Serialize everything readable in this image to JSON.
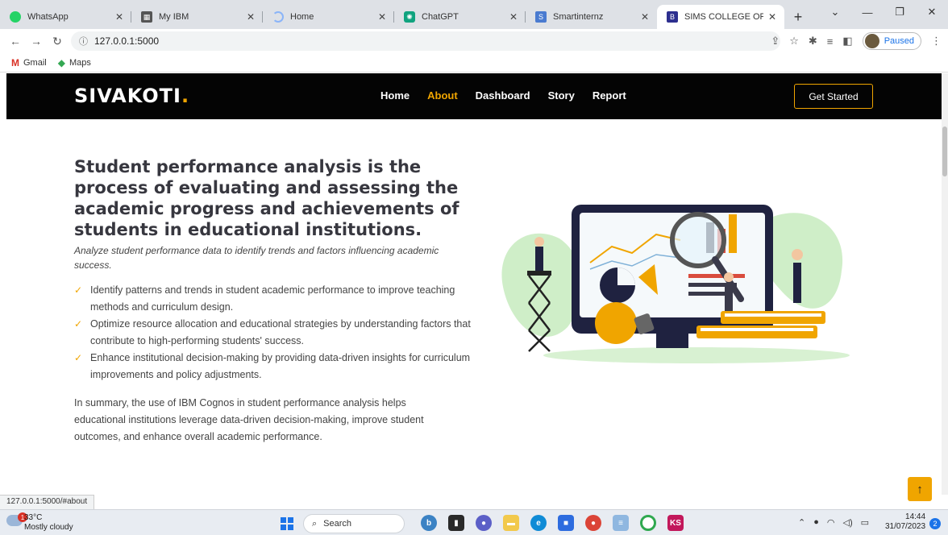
{
  "browser": {
    "tabs": [
      {
        "title": "WhatsApp",
        "icon": "whatsapp-icon",
        "color": "#25d366"
      },
      {
        "title": "My IBM",
        "icon": "ibm-icon",
        "color": "#555555"
      },
      {
        "title": "Home",
        "icon": "home-loading-icon",
        "color": "#8ab4f8"
      },
      {
        "title": "ChatGPT",
        "icon": "chatgpt-icon",
        "color": "#10a37f"
      },
      {
        "title": "Smartinternz",
        "icon": "smartinternz-icon",
        "color": "#4a7bd0"
      },
      {
        "title": "SIMS COLLEGE OF LIFE SCIE",
        "icon": "sims-icon",
        "color": "#2d2f8f",
        "active": true
      }
    ],
    "url": "127.0.0.1:5000",
    "profile_label": "Paused",
    "bookmarks": [
      "Gmail",
      "Maps"
    ],
    "status_url": "127.0.0.1:5000/#about"
  },
  "site": {
    "logo_text": "SIVAKOTI",
    "logo_dot": ".",
    "nav": [
      "Home",
      "About",
      "Dashboard",
      "Story",
      "Report"
    ],
    "nav_active": "About",
    "cta": "Get Started",
    "accent_color": "#f0a500",
    "headline": "Student performance analysis is the process of evaluating and assessing the academic progress and achievements of students in educational institutions.",
    "subtitle": "Analyze student performance data to identify trends and factors influencing academic success.",
    "bullets": [
      "Identify patterns and trends in student academic performance to improve teaching methods and curriculum design.",
      "Optimize resource allocation and educational strategies by understanding factors that contribute to high-performing students' success.",
      "Enhance institutional decision-making by providing data-driven insights for curriculum improvements and policy adjustments."
    ],
    "summary": "In summary, the use of IBM Cognos in student performance analysis helps educational institutions leverage data-driven decision-making, improve student outcomes, and enhance overall academic performance.",
    "scroll_top_icon": "arrow-up-icon"
  },
  "taskbar": {
    "weather_temp": "33°C",
    "weather_desc": "Mostly cloudy",
    "weather_badge": "1",
    "search_label": "Search",
    "time": "14:44",
    "date": "31/07/2023",
    "notification_count": "2"
  }
}
